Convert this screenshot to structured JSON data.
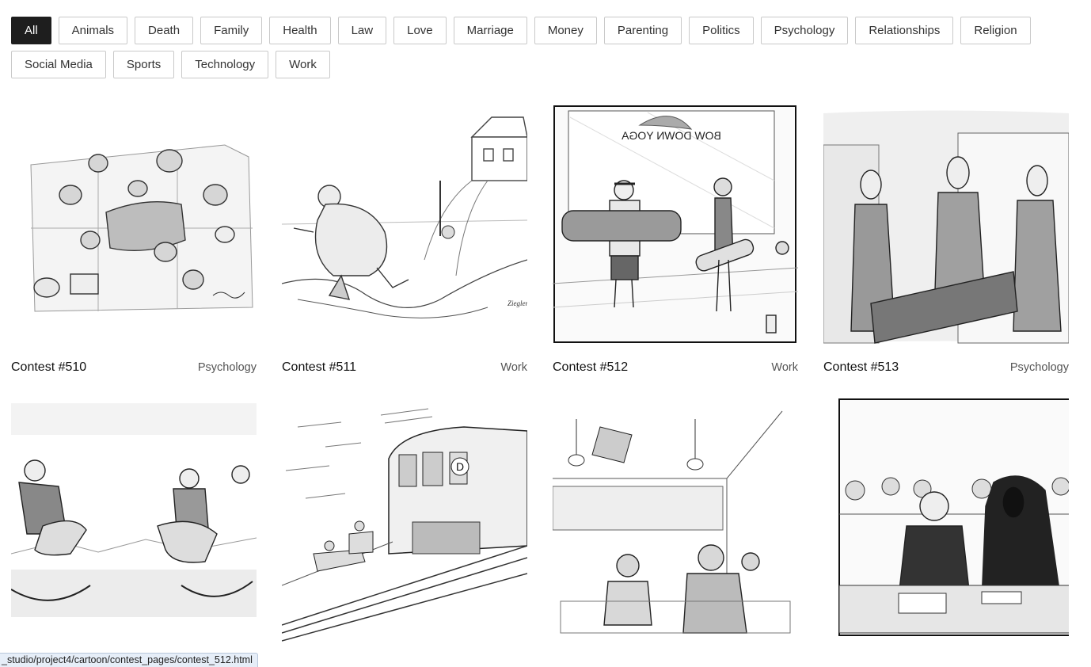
{
  "filters": [
    "All",
    "Animals",
    "Death",
    "Family",
    "Health",
    "Law",
    "Love",
    "Marriage",
    "Money",
    "Parenting",
    "Politics",
    "Psychology",
    "Relationships",
    "Religion",
    "Social Media",
    "Sports",
    "Technology",
    "Work"
  ],
  "active_filter": "All",
  "cards": [
    {
      "title": "Contest #510",
      "category": "Psychology",
      "image": "crowd-overhead-cartoon"
    },
    {
      "title": "Contest #511",
      "category": "Work",
      "image": "snow-shoveling-cartoon"
    },
    {
      "title": "Contest #512",
      "category": "Work",
      "image": "yoga-studio-cartoon",
      "sign_text": "BOW DOWN YOGA"
    },
    {
      "title": "Contest #513",
      "category": "Psychology",
      "image": "businessmen-carrying-cartoon"
    },
    {
      "title": "",
      "category": "",
      "image": "rocking-horse-cowboys-cartoon"
    },
    {
      "title": "",
      "category": "",
      "image": "subway-train-cartoon",
      "train_letter": "D"
    },
    {
      "title": "",
      "category": "",
      "image": "diner-cartoon"
    },
    {
      "title": "",
      "category": "",
      "image": "grim-reaper-court-cartoon"
    }
  ],
  "status_url": "_studio/project4/cartoon/contest_pages/contest_512.html"
}
